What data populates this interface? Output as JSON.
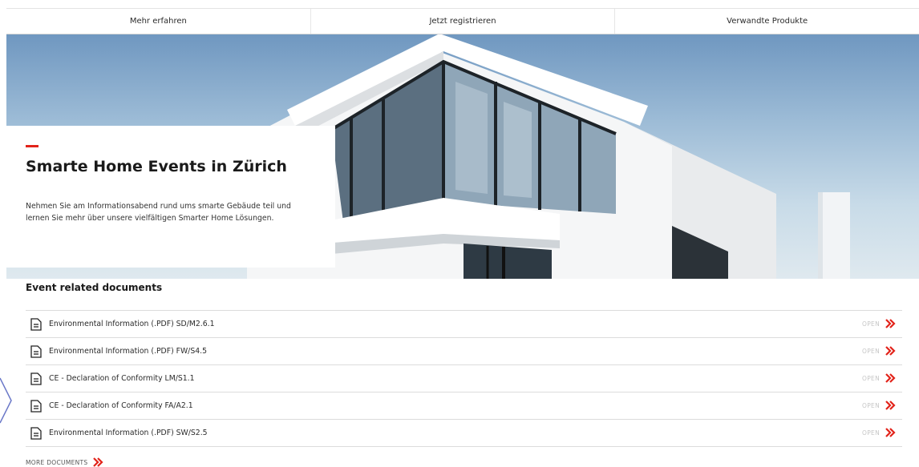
{
  "tabs": [
    {
      "label": "Mehr erfahren"
    },
    {
      "label": "Jetzt registrieren"
    },
    {
      "label": "Verwandte Produkte"
    }
  ],
  "hero": {
    "title": "Smarte Home Events in Zürich",
    "text": "Nehmen Sie am Informationsabend rund ums smarte Gebäude teil und lernen Sie mehr über unsere vielfältigen Smarter Home Lösungen."
  },
  "documents": {
    "heading": "Event related documents",
    "open_label": "OPEN",
    "items": [
      {
        "label": "Environmental Information (.PDF) SD/M2.6.1"
      },
      {
        "label": "Environmental Information (.PDF) FW/S4.5"
      },
      {
        "label": "CE - Declaration of Conformity LM/S1.1"
      },
      {
        "label": "CE - Declaration of Conformity FA/A2.1"
      },
      {
        "label": "Environmental Information (.PDF) SW/S2.5"
      }
    ],
    "more_label": "MORE DOCUMENTS"
  },
  "colors": {
    "accent": "#e2231a",
    "divider": "#dcdcdc",
    "open_text": "#c6c6c6"
  },
  "icons": {
    "document": "document-icon",
    "chevron": "double-chevron-right-icon"
  }
}
